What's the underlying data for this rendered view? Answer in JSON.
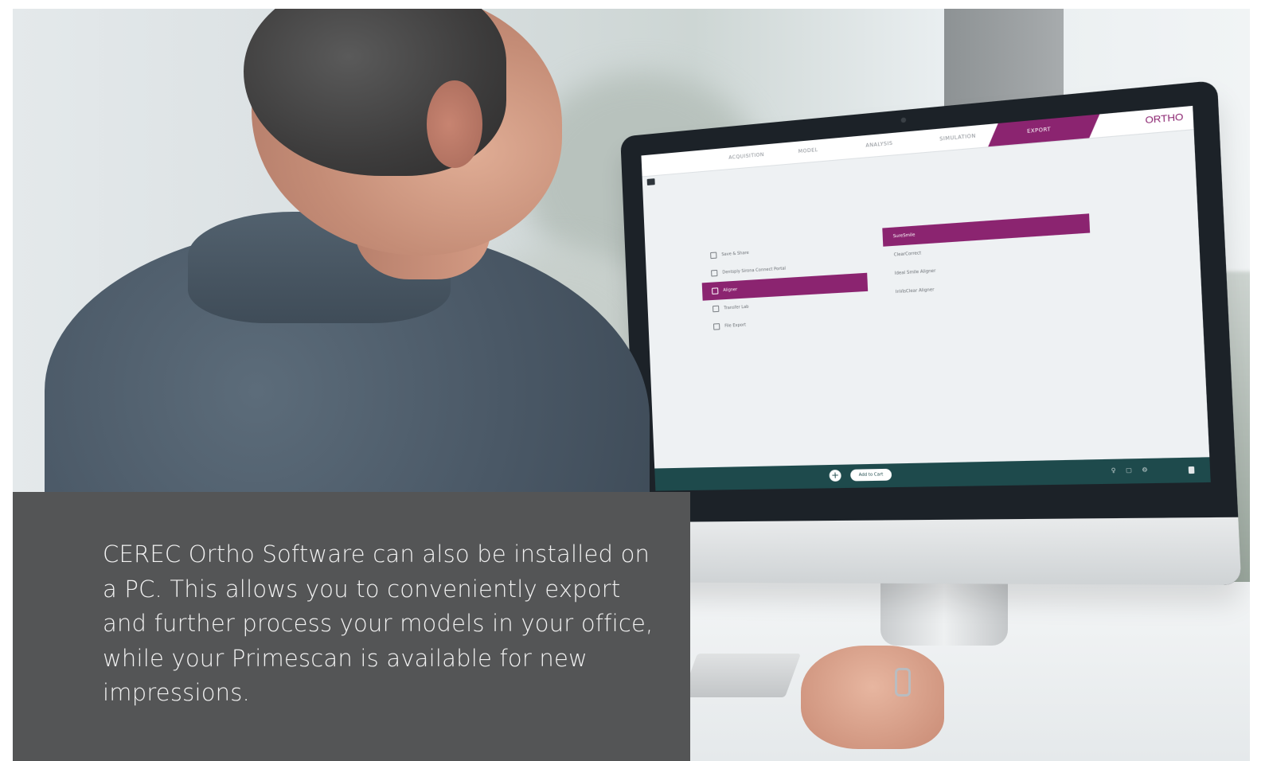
{
  "caption": {
    "text": "CEREC Ortho Software can also be installed on a PC. This allows you to conveniently export and further process your models in your office, while your Primescan is available for new impressions."
  },
  "screen": {
    "tabs": [
      "ACQUISITION",
      "MODEL",
      "ANALYSIS",
      "SIMULATION"
    ],
    "active_tab": "EXPORT",
    "brand": "ORTHO",
    "left_list": [
      {
        "label": "Save & Share",
        "icon": "share-icon"
      },
      {
        "label": "Dentsply Sirona Connect Portal",
        "icon": "link-icon"
      },
      {
        "label": "Aligner",
        "icon": "aligner-icon",
        "selected": true
      },
      {
        "label": "Transfer Lab",
        "icon": "transfer-icon"
      },
      {
        "label": "File Export",
        "icon": "file-icon"
      }
    ],
    "right_list": [
      {
        "label": "SureSmile",
        "selected": true
      },
      {
        "label": "ClearCorrect"
      },
      {
        "label": "Ideal Smile Aligner"
      },
      {
        "label": "InVisClear Aligner"
      }
    ],
    "bottom": {
      "add_button": "+",
      "cart_button": "Add to Cart"
    }
  },
  "colors": {
    "accent": "#8b2470",
    "caption_bg": "#545556",
    "bottom_bar": "#1e4a4c"
  }
}
